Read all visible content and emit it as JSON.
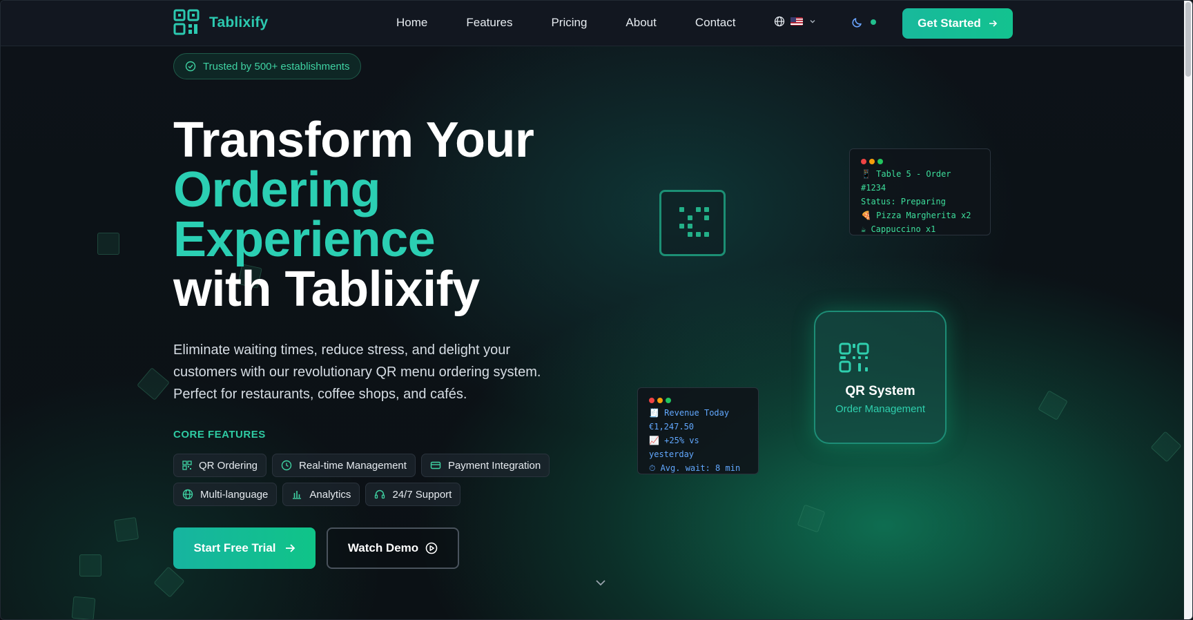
{
  "nav": {
    "brand": "Tablixify",
    "links": [
      "Home",
      "Features",
      "Pricing",
      "About",
      "Contact"
    ],
    "cta": "Get Started"
  },
  "hero": {
    "badge": "Trusted by 500+ establishments",
    "title_line1": "Transform Your",
    "title_line2": "Ordering",
    "title_line3": "Experience",
    "title_line4": "with Tablixify",
    "subtitle_line1": "Eliminate waiting times, reduce stress, and delight your",
    "subtitle_line2": "customers with our revolutionary QR menu ordering system.",
    "subtitle_line3": "Perfect for restaurants, coffee shops, and cafés.",
    "features_label": "CORE FEATURES",
    "features": [
      {
        "label": "QR Ordering",
        "icon": "qr-icon"
      },
      {
        "label": "Real-time Management",
        "icon": "clock-icon"
      },
      {
        "label": "Payment Integration",
        "icon": "credit-card-icon"
      },
      {
        "label": "Multi-language",
        "icon": "globe-icon"
      },
      {
        "label": "Analytics",
        "icon": "bar-chart-icon"
      },
      {
        "label": "24/7 Support",
        "icon": "headset-icon"
      }
    ],
    "primary_cta": "Start Free Trial",
    "secondary_cta": "Watch Demo"
  },
  "order_card": {
    "line1": "📱 Table 5 - Order #1234",
    "line2": "Status: Preparing",
    "line3": "🍕 Pizza Margherita x2",
    "line4": "☕ Cappuccino x1"
  },
  "revenue_card": {
    "line1": "🧾 Revenue Today",
    "line2": "€1,247.50",
    "line3": "📈 +25% vs yesterday",
    "line4": "⏱ Avg. wait: 8 min"
  },
  "qr_system_card": {
    "title": "QR System",
    "subtitle": "Order Management"
  },
  "colors": {
    "accent": "#2bcfb3",
    "accent_green": "#10c488",
    "background": "#0b0f14"
  }
}
